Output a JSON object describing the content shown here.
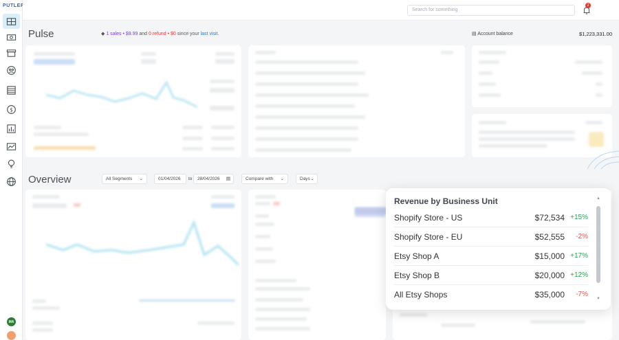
{
  "app": {
    "logo": "PUTLER"
  },
  "sidebar": {
    "items": [
      {
        "icon": "dashboard-icon",
        "active": true
      },
      {
        "icon": "money-icon"
      },
      {
        "icon": "archive-icon"
      },
      {
        "icon": "customers-icon"
      },
      {
        "icon": "list-icon"
      },
      {
        "icon": "dollar-icon"
      },
      {
        "icon": "analytics-icon"
      },
      {
        "icon": "trend-chart-icon"
      },
      {
        "icon": "lightbulb-icon"
      },
      {
        "icon": "globe-icon"
      }
    ],
    "user_initials": "MA"
  },
  "topbar": {
    "search_placeholder": "Search for something",
    "notification_count": "2"
  },
  "pulse": {
    "title": "Pulse",
    "sales_text": "1 sales • $9.99",
    "and_text": "and",
    "refund_text": "0 refund • $0",
    "since_text": "since your",
    "last_visit_text": "last visit.",
    "account_balance_label": "Account balance",
    "account_balance_value": "$1,223,331.00"
  },
  "overview": {
    "title": "Overview",
    "segment_select": "All Segments",
    "date_from": "01/04/2026",
    "date_to_label": "to",
    "date_to": "28/04/2026",
    "compare_select": "Compare with",
    "granularity_select": "Days"
  },
  "revenue_popup": {
    "title": "Revenue by Business Unit",
    "rows": [
      {
        "name": "Shopify Store - US",
        "value": "$72,534",
        "change": "+15%",
        "direction": "up"
      },
      {
        "name": "Shopify Store - EU",
        "value": "$52,555",
        "change": "-2%",
        "direction": "down"
      },
      {
        "name": "Etsy Shop A",
        "value": "$15,000",
        "change": "+17%",
        "direction": "up"
      },
      {
        "name": "Etsy Shop B",
        "value": "$20,000",
        "change": "+12%",
        "direction": "up"
      },
      {
        "name": "All Etsy Shops",
        "value": "$35,000",
        "change": "-7%",
        "direction": "down"
      }
    ]
  },
  "colors": {
    "accent": "#2a67b1",
    "positive": "#23a455",
    "negative": "#e5534b",
    "chart_line": "#7fd0e6"
  }
}
